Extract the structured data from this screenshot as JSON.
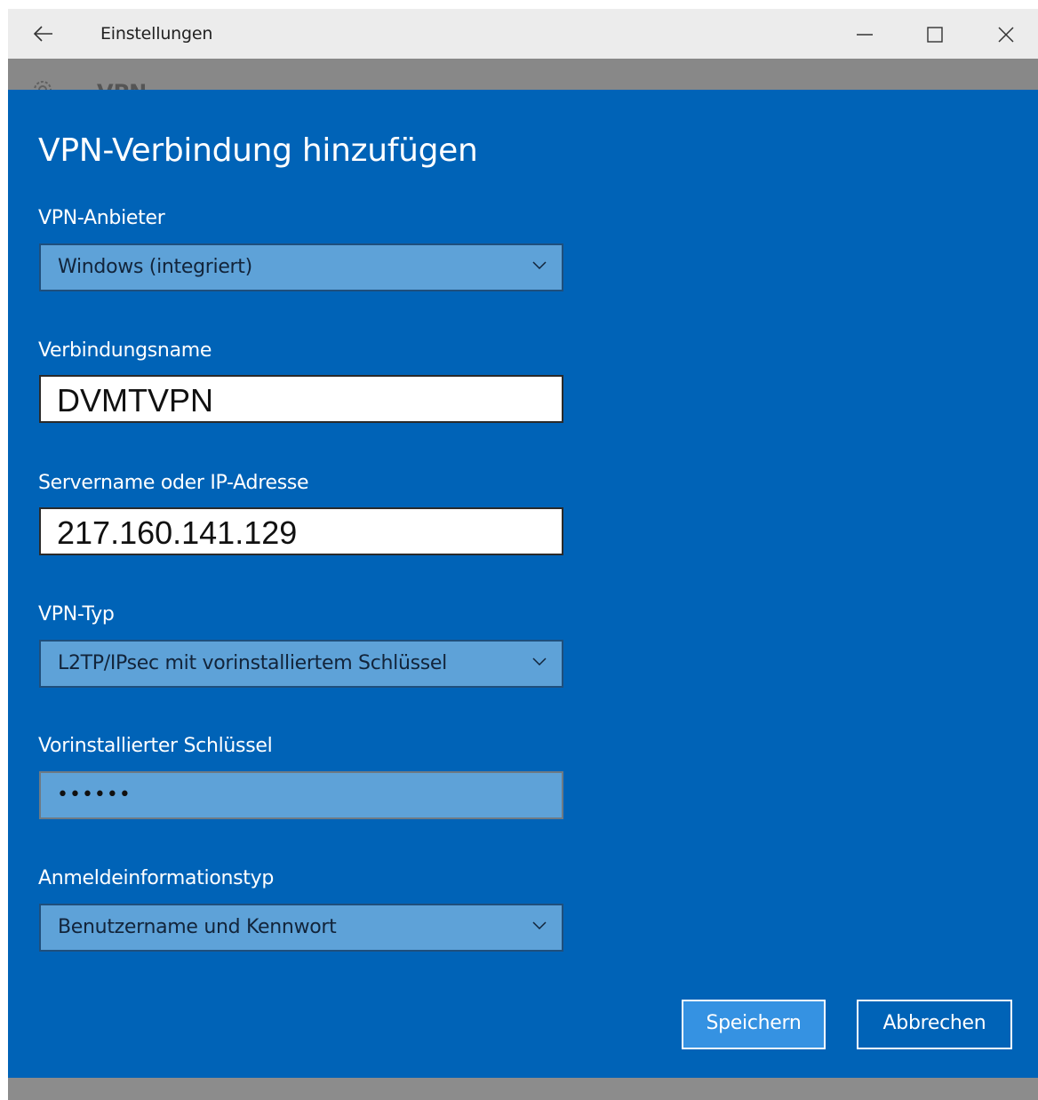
{
  "window": {
    "title": "Einstellungen",
    "behind_header": "VPN"
  },
  "dialog": {
    "title": "VPN-Verbindung hinzufügen",
    "fields": {
      "provider": {
        "label": "VPN-Anbieter",
        "value": "Windows (integriert)"
      },
      "connection_name": {
        "label": "Verbindungsname",
        "value": "DVMTVPN"
      },
      "server": {
        "label": "Servername oder IP-Adresse",
        "value": "217.160.141.129"
      },
      "vpn_type": {
        "label": "VPN-Typ",
        "value": "L2TP/IPsec mit vorinstalliertem Schlüssel"
      },
      "preshared_key": {
        "label": "Vorinstallierter Schlüssel",
        "value": "••••••"
      },
      "credential_type": {
        "label": "Anmeldeinformationstyp",
        "value": "Benutzername und Kennwort"
      }
    },
    "buttons": {
      "save": "Speichern",
      "cancel": "Abbrechen"
    }
  },
  "colors": {
    "dialog_background": "#0063b7",
    "field_background": "#5ea2d8",
    "titlebar_background": "#ececec",
    "primary_button": "#3592e2"
  },
  "icons": {
    "back": "arrow-left-icon",
    "minimize": "minimize-icon",
    "maximize": "maximize-icon",
    "close": "close-icon",
    "settings": "gear-icon",
    "dropdown": "chevron-down-icon"
  }
}
